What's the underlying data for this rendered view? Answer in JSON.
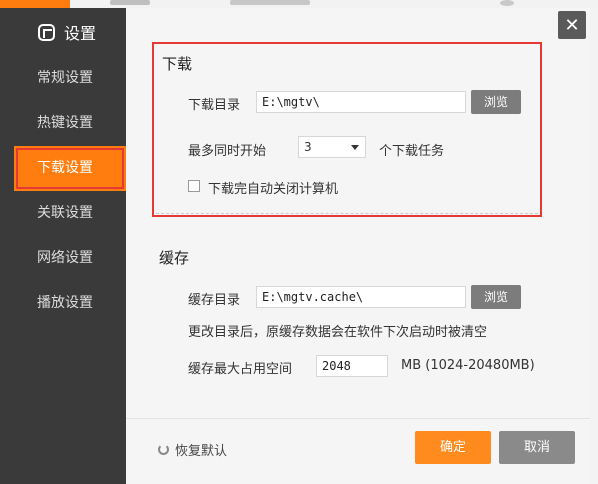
{
  "window": {
    "title": "设置"
  },
  "sidebar": {
    "items": [
      {
        "label": "常规设置"
      },
      {
        "label": "热键设置"
      },
      {
        "label": "下载设置"
      },
      {
        "label": "关联设置"
      },
      {
        "label": "网络设置"
      },
      {
        "label": "播放设置"
      }
    ]
  },
  "download": {
    "title": "下载",
    "dir_label": "下载目录",
    "dir_value": "E:\\mgtv\\",
    "browse_label": "浏览",
    "max_label": "最多同时开始",
    "max_value": "3",
    "max_suffix": "个下载任务",
    "shutdown_label": "下载完自动关闭计算机"
  },
  "cache": {
    "title": "缓存",
    "dir_label": "缓存目录",
    "dir_value": "E:\\mgtv.cache\\",
    "browse_label": "浏览",
    "note": "更改目录后，原缓存数据会在软件下次启动时被清空",
    "max_label": "缓存最大占用空间",
    "max_value": "2048",
    "max_unit": "MB (1024-20480MB)"
  },
  "footer": {
    "restore_label": "恢复默认",
    "ok_label": "确定",
    "cancel_label": "取消"
  },
  "colors": {
    "accent": "#ff7d0e",
    "highlight_border": "#e53935",
    "sidebar_bg": "#3a3a3a"
  }
}
